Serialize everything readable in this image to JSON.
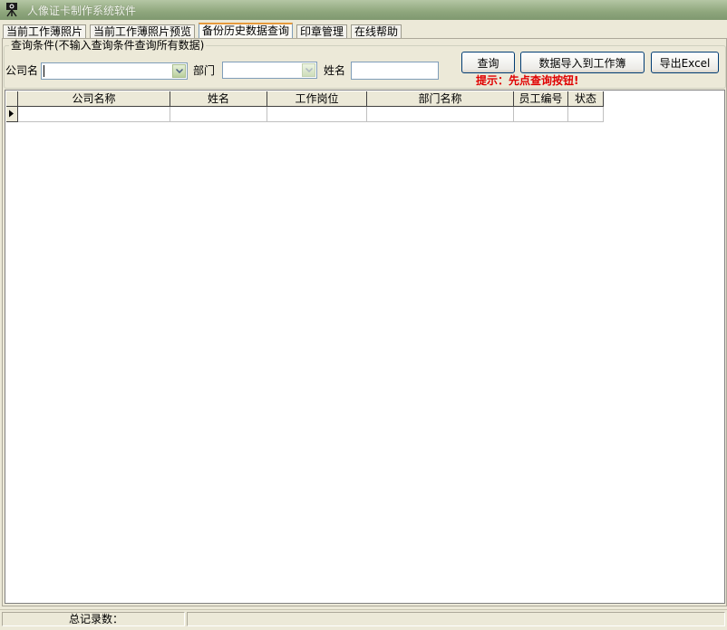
{
  "window": {
    "title": "人像证卡制作系统软件",
    "icon": "camera-icon"
  },
  "tabs": [
    {
      "label": "当前工作薄照片",
      "active": false
    },
    {
      "label": "当前工作薄照片预览",
      "active": false
    },
    {
      "label": "备份历史数据查询",
      "active": true
    },
    {
      "label": "印章管理",
      "active": false
    },
    {
      "label": "在线帮助",
      "active": false
    }
  ],
  "query": {
    "group_label": "查询条件(不输入查询条件查询所有数据)",
    "company_label": "公司名",
    "company_value": "",
    "department_label": "部门",
    "department_value": "",
    "name_label": "姓名",
    "name_value": "",
    "query_button": "查询",
    "import_button": "数据导入到工作簿",
    "export_button": "导出Excel",
    "hint": "提示：先点查询按钮!"
  },
  "table": {
    "columns": [
      "公司名称",
      "姓名",
      "工作岗位",
      "部门名称",
      "员工编号",
      "状态"
    ],
    "rows": [
      [
        "",
        "",
        "",
        "",
        "",
        ""
      ]
    ]
  },
  "status": {
    "total_label": "总记录数：",
    "total_value": ""
  }
}
